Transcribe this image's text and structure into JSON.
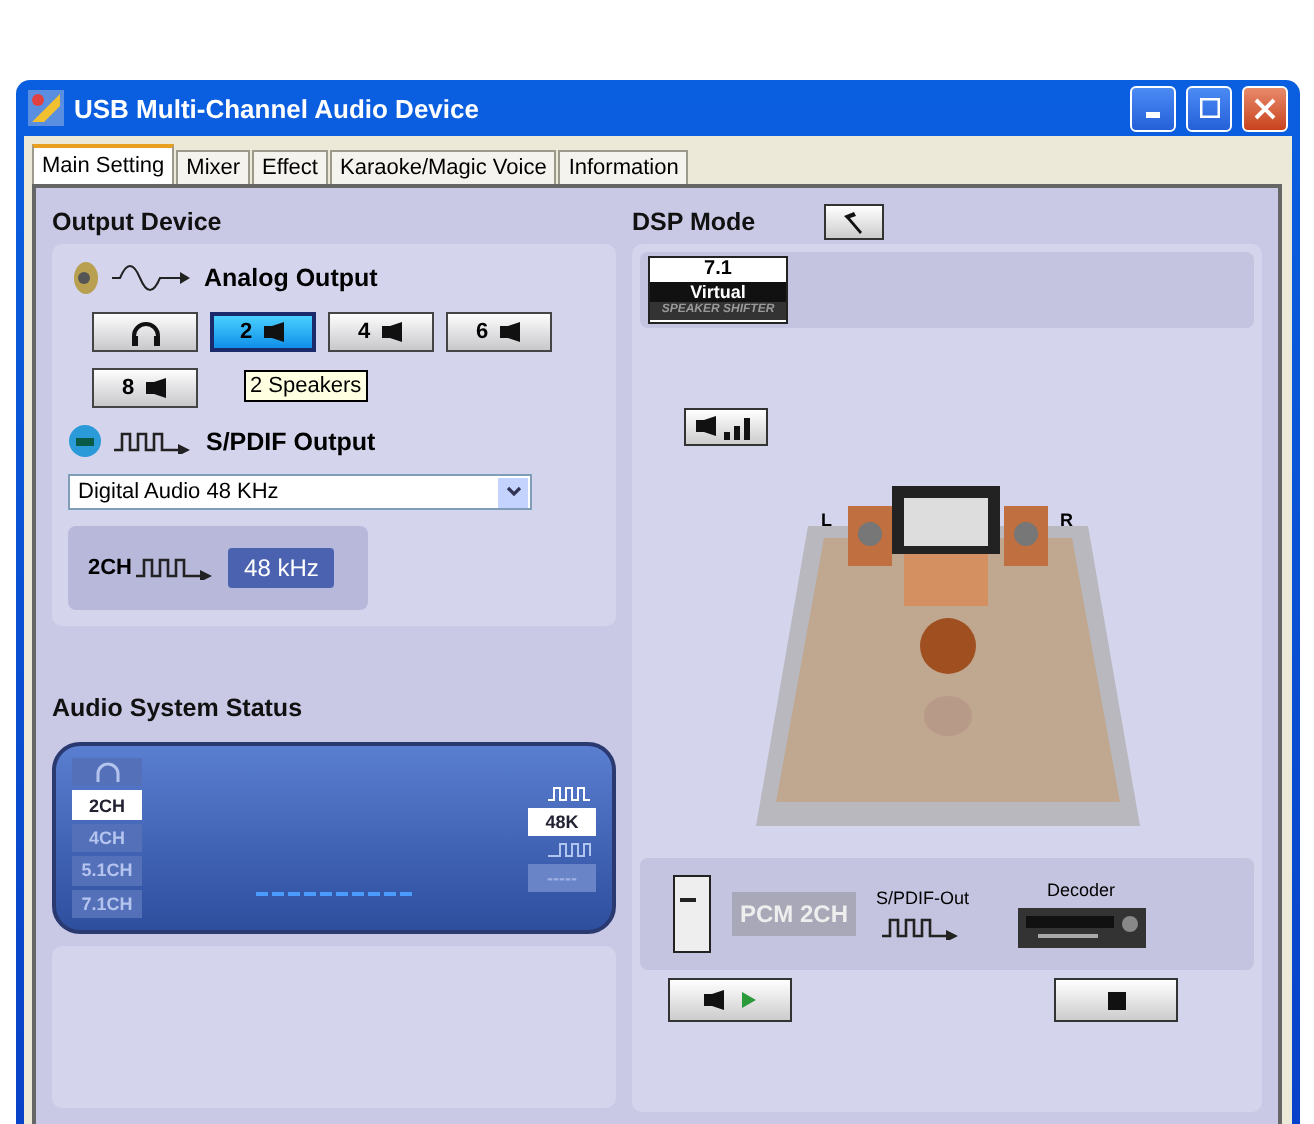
{
  "window": {
    "title": "USB Multi-Channel Audio Device"
  },
  "tabs": [
    {
      "label": "Main Setting",
      "selected": true
    },
    {
      "label": "Mixer",
      "selected": false
    },
    {
      "label": "Effect",
      "selected": false
    },
    {
      "label": "Karaoke/Magic Voice",
      "selected": false
    },
    {
      "label": "Information",
      "selected": false
    }
  ],
  "output_device": {
    "title": "Output Device",
    "analog_label": "Analog Output",
    "speaker_buttons": [
      {
        "kind": "headphones",
        "selected": false
      },
      {
        "kind": "speakers",
        "label": "2",
        "selected": true
      },
      {
        "kind": "speakers",
        "label": "4",
        "selected": false
      },
      {
        "kind": "speakers",
        "label": "6",
        "selected": false
      },
      {
        "kind": "speakers",
        "label": "8",
        "selected": false
      }
    ],
    "tooltip": "2 Speakers",
    "spdif_label": "S/PDIF Output",
    "spdif_select": {
      "value": "Digital Audio 48 KHz"
    },
    "spdif_channel": "2CH",
    "spdif_rate": "48 kHz"
  },
  "audio_status": {
    "title": "Audio System Status",
    "channels": [
      {
        "kind": "headphones",
        "on": false
      },
      {
        "kind": "text",
        "label": "2CH",
        "on": true
      },
      {
        "kind": "text",
        "label": "4CH",
        "on": false
      },
      {
        "kind": "text",
        "label": "5.1CH",
        "on": false
      },
      {
        "kind": "text",
        "label": "7.1CH",
        "on": false
      }
    ],
    "output_rate": "48K",
    "input_rate": "-----"
  },
  "dsp": {
    "title": "DSP Mode",
    "mode_badge": {
      "number": "7.1",
      "name": "Virtual",
      "caption": "SPEAKER SHIFTER"
    },
    "stage": {
      "left": "L",
      "right": "R"
    },
    "chain": {
      "source": "PCM 2CH",
      "link": "S/PDIF-Out",
      "target": "Decoder"
    }
  }
}
